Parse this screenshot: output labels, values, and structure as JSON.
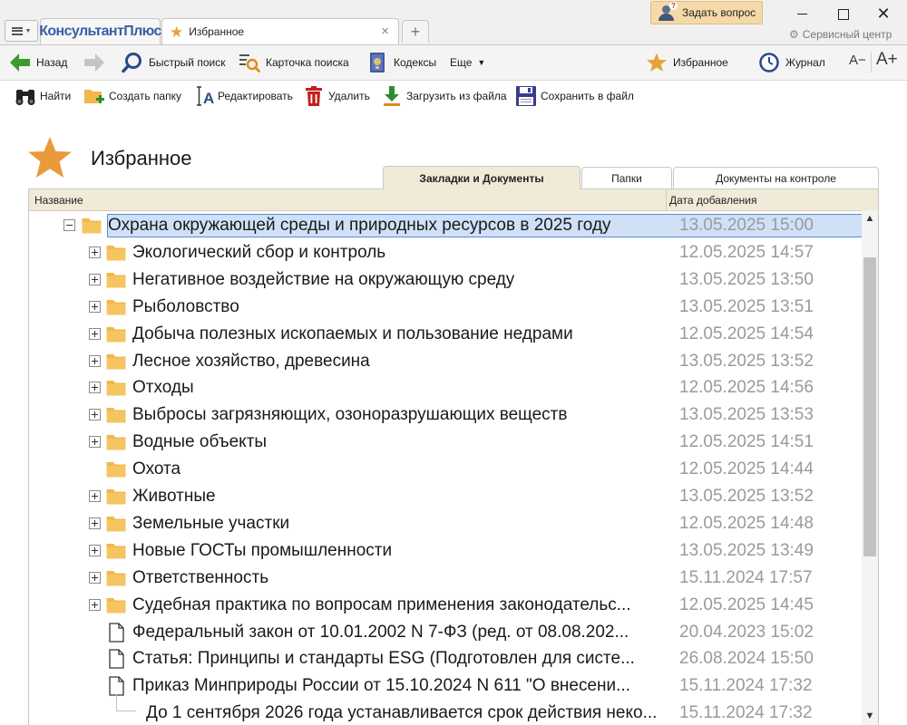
{
  "titlebar": {
    "brand": "КонсультантПлюс",
    "active_tab": "Избранное",
    "ask_button": "Задать вопрос",
    "service_center": "Сервисный центр"
  },
  "toolbar": {
    "back": "Назад",
    "quick_search": "Быстрый поиск",
    "search_card": "Карточка поиска",
    "codes": "Кодексы",
    "more": "Еще",
    "favorites": "Избранное",
    "journal": "Журнал",
    "font_decrease": "A−",
    "font_increase": "A+"
  },
  "actions": {
    "find": "Найти",
    "create_folder": "Создать папку",
    "edit": "Редактировать",
    "delete": "Удалить",
    "load_from_file": "Загрузить из файла",
    "save_to_file": "Сохранить в файл"
  },
  "page": {
    "title": "Избранное"
  },
  "tabs": [
    {
      "label": "Закладки и Документы",
      "active": true
    },
    {
      "label": "Папки",
      "active": false
    },
    {
      "label": "Документы на контроле",
      "active": false
    }
  ],
  "grid": {
    "col_name": "Название",
    "col_date": "Дата добавления",
    "rows": [
      {
        "type": "folder",
        "level": 0,
        "expanded": true,
        "selected": true,
        "title": "Охрана окружающей среды и природных ресурсов в 2025 году",
        "date": "13.05.2025 15:00"
      },
      {
        "type": "folder",
        "level": 1,
        "expanded": false,
        "title": "Экологический сбор и контроль",
        "date": "12.05.2025 14:57"
      },
      {
        "type": "folder",
        "level": 1,
        "expanded": false,
        "title": "Негативное воздействие на окружающую среду",
        "date": "13.05.2025 13:50"
      },
      {
        "type": "folder",
        "level": 1,
        "expanded": false,
        "title": "Рыболовство",
        "date": "13.05.2025 13:51"
      },
      {
        "type": "folder",
        "level": 1,
        "expanded": false,
        "title": "Добыча полезных ископаемых и пользование недрами",
        "date": "12.05.2025 14:54"
      },
      {
        "type": "folder",
        "level": 1,
        "expanded": false,
        "title": "Лесное хозяйство, древесина",
        "date": "13.05.2025 13:52"
      },
      {
        "type": "folder",
        "level": 1,
        "expanded": false,
        "title": "Отходы",
        "date": "12.05.2025 14:56"
      },
      {
        "type": "folder",
        "level": 1,
        "expanded": false,
        "title": "Выбросы загрязняющих, озоноразрушающих веществ",
        "date": "13.05.2025 13:53"
      },
      {
        "type": "folder",
        "level": 1,
        "expanded": false,
        "title": "Водные объекты",
        "date": "12.05.2025 14:51"
      },
      {
        "type": "folder",
        "level": 1,
        "expanded": null,
        "title": "Охота",
        "date": "12.05.2025 14:44"
      },
      {
        "type": "folder",
        "level": 1,
        "expanded": false,
        "title": "Животные",
        "date": "13.05.2025 13:52"
      },
      {
        "type": "folder",
        "level": 1,
        "expanded": false,
        "title": "Земельные участки",
        "date": "12.05.2025 14:48"
      },
      {
        "type": "folder",
        "level": 1,
        "expanded": false,
        "title": "Новые ГОСТы промышленности",
        "date": "13.05.2025 13:49"
      },
      {
        "type": "folder",
        "level": 1,
        "expanded": false,
        "title": "Ответственность",
        "date": "15.11.2024 17:57"
      },
      {
        "type": "folder",
        "level": 1,
        "expanded": false,
        "title": "Судебная практика по вопросам применения законодательс...",
        "date": "12.05.2025 14:45"
      },
      {
        "type": "doc",
        "level": 1,
        "title": "Федеральный закон от 10.01.2002 N 7-ФЗ (ред. от 08.08.202...",
        "date": "20.04.2023 15:02"
      },
      {
        "type": "doc",
        "level": 1,
        "title": "Статья: Принципы и стандарты ESG (Подготовлен для систе...",
        "date": "26.08.2024 15:50"
      },
      {
        "type": "doc",
        "level": 1,
        "title": "Приказ Минприроды России от 15.10.2024 N 611 \"О внесени...",
        "date": "15.11.2024 17:32"
      },
      {
        "type": "bookmark",
        "level": 2,
        "title": "До 1 сентября 2026 года устанавливается срок действия неко...",
        "date": "15.11.2024 17:32"
      }
    ]
  },
  "colors": {
    "accent_star": "#e6a33a",
    "folder": "#f2b84b",
    "header_beige": "#f1ead9",
    "selection": "#cfe0f7",
    "date_gray": "#9a9a9a",
    "back_arrow": "#3d9a2f"
  },
  "icons": {
    "menu": "hamburger-icon",
    "favorite": "star-icon",
    "back": "arrow-left-icon",
    "forward": "arrow-right-icon",
    "quick_search": "magnifier-icon",
    "search_card": "search-card-icon",
    "codes": "codes-book-icon",
    "journal": "clock-icon",
    "find": "binoculars-icon",
    "create_folder": "folder-plus-icon",
    "edit": "edit-cursor-icon",
    "delete": "trash-icon",
    "load": "download-icon",
    "save": "floppy-icon"
  }
}
